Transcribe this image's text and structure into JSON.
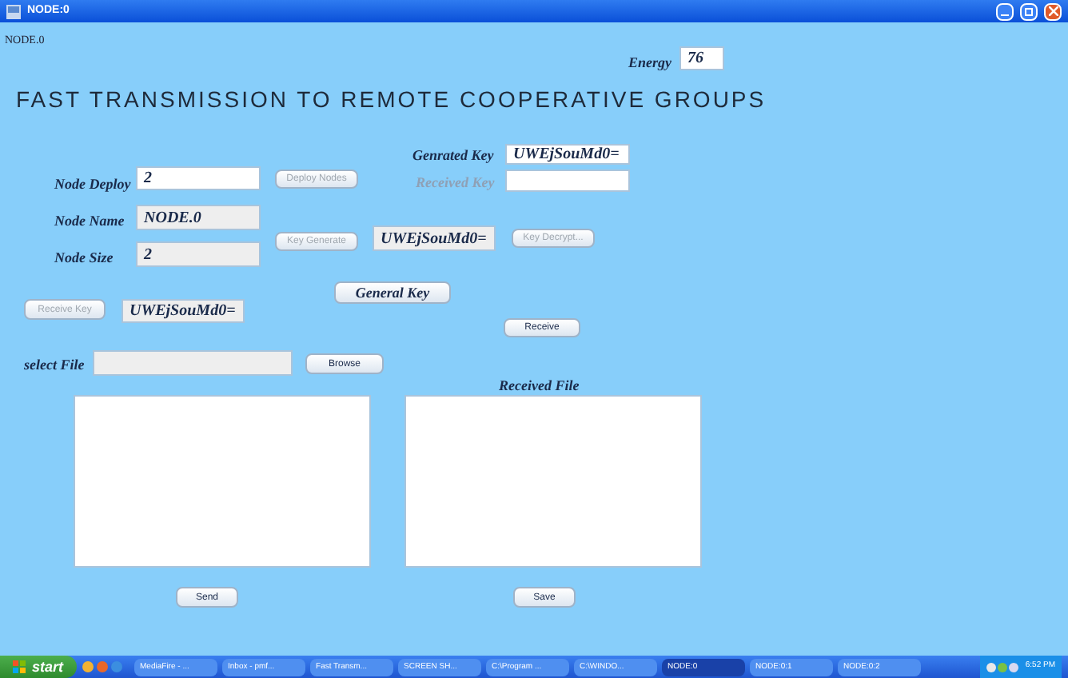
{
  "window": {
    "title": "NODE:0"
  },
  "node_label": "NODE.0",
  "energy": {
    "label": "Energy",
    "value": "76"
  },
  "heading": "FAST TRANSMISSION TO REMOTE COOPERATIVE GROUPS",
  "generated_key": {
    "label": "Genrated Key",
    "value": "UWEjSouMd0="
  },
  "received_key": {
    "label": "Received Key",
    "disabled": true
  },
  "node_deploy": {
    "label": "Node Deploy",
    "value": "2"
  },
  "deploy_button": {
    "label": "Deploy Nodes",
    "disabled": true
  },
  "node_name": {
    "label": "Node Name",
    "value": "NODE.0"
  },
  "node_size": {
    "label": "Node Size",
    "value": "2"
  },
  "key_generate_button": {
    "label": "Key Generate",
    "disabled": true
  },
  "key_value": "UWEjSouMd0=",
  "key_decrypt_button": {
    "label": "Key Decrypt...",
    "disabled": true
  },
  "general_key_button": {
    "label": "General Key",
    "disabled": false
  },
  "receive_key_button": {
    "label": "Receive Key",
    "disabled": true
  },
  "receive_key_value": "UWEjSouMd0=",
  "receive_button": {
    "label": "Receive",
    "disabled": false
  },
  "select_file": {
    "label": "select File"
  },
  "browse_button": {
    "label": "Browse",
    "disabled": false
  },
  "received_file_label": "Received File",
  "send_button": {
    "label": "Send",
    "disabled": false
  },
  "save_button": {
    "label": "Save",
    "disabled": false
  },
  "taskbar": {
    "start": "start",
    "clock": "6:52 PM",
    "items": [
      {
        "label": "MediaFire - ...",
        "selected": false
      },
      {
        "label": "Inbox - pmf...",
        "selected": false
      },
      {
        "label": "Fast Transm...",
        "selected": false
      },
      {
        "label": "SCREEN SH...",
        "selected": false
      },
      {
        "label": "C:\\Program ...",
        "selected": false
      },
      {
        "label": "C:\\WINDO...",
        "selected": false
      },
      {
        "label": "NODE:0",
        "selected": true
      },
      {
        "label": "NODE:0:1",
        "selected": false
      },
      {
        "label": "NODE:0:2",
        "selected": false
      }
    ]
  }
}
